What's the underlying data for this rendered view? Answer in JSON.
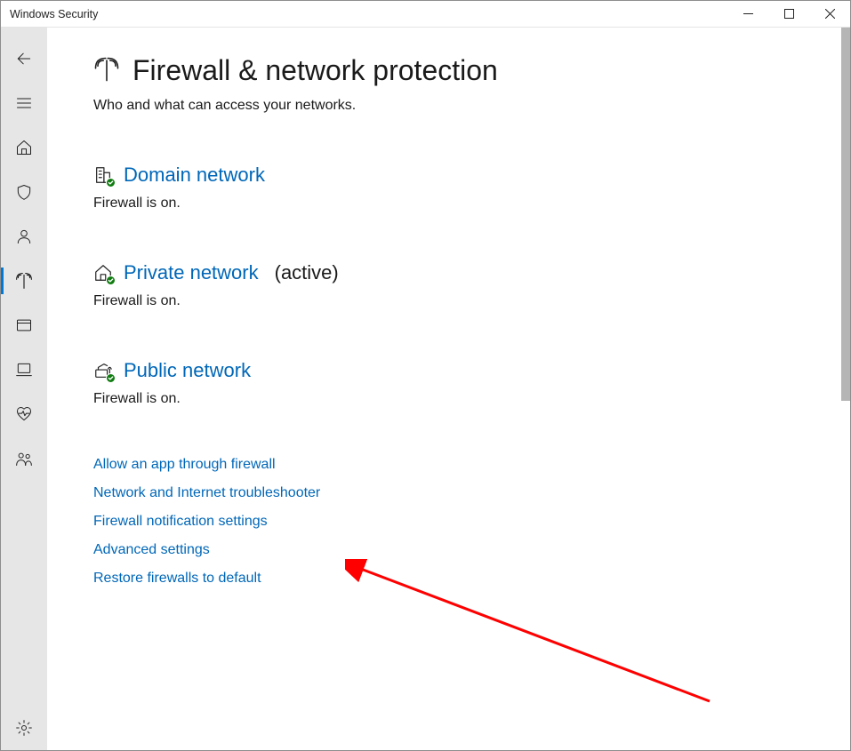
{
  "window": {
    "title": "Windows Security"
  },
  "page": {
    "title": "Firewall & network protection",
    "subtitle": "Who and what can access your networks."
  },
  "networks": {
    "domain": {
      "label": "Domain network",
      "status": "Firewall is on."
    },
    "private": {
      "label": "Private network",
      "active_suffix": "(active)",
      "status": "Firewall is on."
    },
    "public": {
      "label": "Public network",
      "status": "Firewall is on."
    }
  },
  "links": {
    "allow_app": "Allow an app through firewall",
    "troubleshooter": "Network and Internet troubleshooter",
    "notifications": "Firewall notification settings",
    "advanced": "Advanced settings",
    "restore": "Restore firewalls to default"
  }
}
